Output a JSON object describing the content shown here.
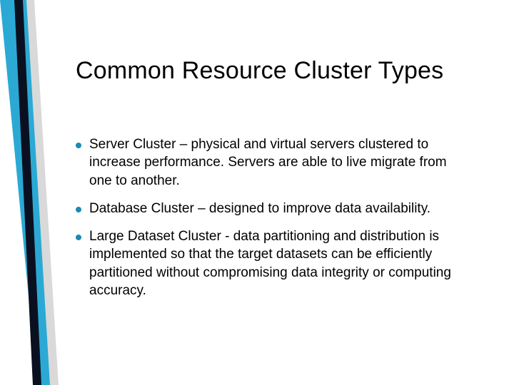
{
  "title": "Common Resource Cluster Types",
  "bullets": [
    "Server Cluster – physical and virtual servers clustered to increase performance. Servers are able to live migrate from one to another.",
    "Database Cluster – designed to improve data availability.",
    "Large Dataset Cluster - data partitioning and distribution is implemented so that the target datasets can be efficiently partitioned without compromising data integrity or computing accuracy."
  ],
  "accent_color": "#1a8bb3"
}
